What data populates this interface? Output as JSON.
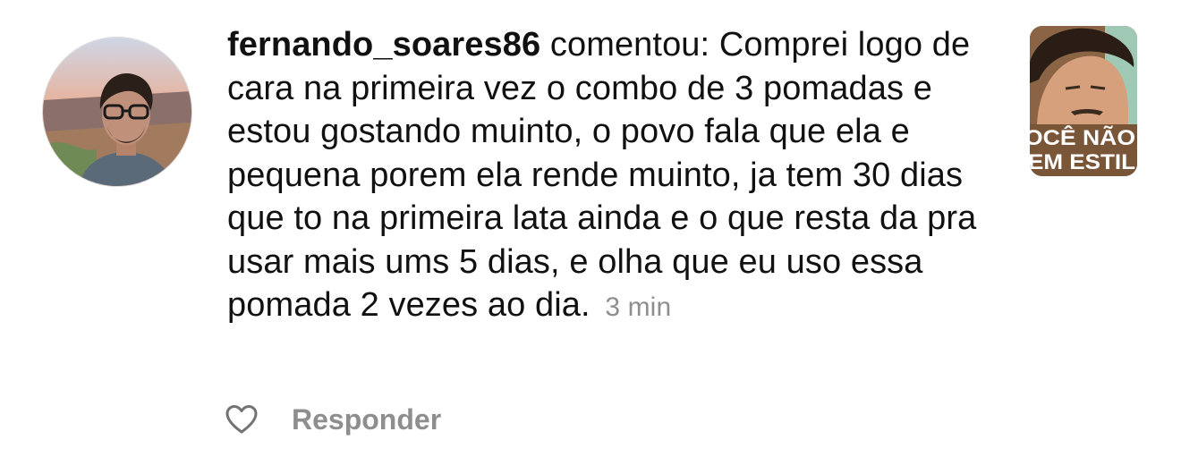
{
  "comment": {
    "username": "fernando_soares86",
    "action": " comentou: ",
    "text": "Comprei logo de cara na primeira vez o combo de 3 pomadas e estou gostando muinto, o povo fala que ela e pequena porem ela rende muinto, ja tem 30 dias que to na primeira lata ainda e o que resta da pra usar mais ums 5 dias, e olha que eu uso essa pomada 2 vezes ao dia.",
    "timestamp": "3 min"
  },
  "thumbnail": {
    "caption_line1": "OCÊ NÃO",
    "caption_line2": "EM ESTIL"
  },
  "actions": {
    "reply_label": "Responder",
    "like_icon": "heart-outline-icon"
  },
  "colors": {
    "text": "#111111",
    "muted": "#8e8e8e",
    "thumbnail_bg": "#7e5b3b"
  }
}
